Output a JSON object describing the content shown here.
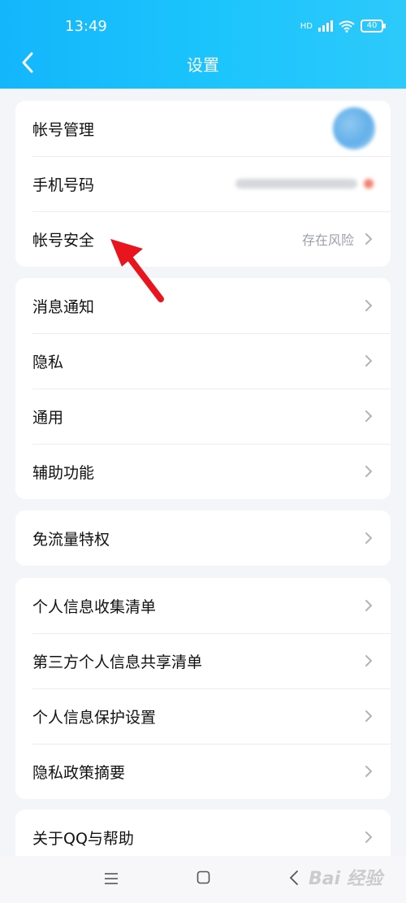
{
  "status_bar": {
    "time": "13:49",
    "network": "HD",
    "battery": "40"
  },
  "header": {
    "title": "设置"
  },
  "sections": [
    {
      "rows": [
        {
          "label": "帐号管理",
          "value": ""
        },
        {
          "label": "手机号码",
          "value": ""
        },
        {
          "label": "帐号安全",
          "value": "存在风险"
        }
      ]
    },
    {
      "rows": [
        {
          "label": "消息通知"
        },
        {
          "label": "隐私"
        },
        {
          "label": "通用"
        },
        {
          "label": "辅助功能"
        }
      ]
    },
    {
      "rows": [
        {
          "label": "免流量特权"
        }
      ]
    },
    {
      "rows": [
        {
          "label": "个人信息收集清单"
        },
        {
          "label": "第三方个人信息共享清单"
        },
        {
          "label": "个人信息保护设置"
        },
        {
          "label": "隐私政策摘要"
        }
      ]
    },
    {
      "rows": [
        {
          "label": "关于QQ与帮助"
        }
      ]
    }
  ],
  "watermark": "Bai 经验",
  "colors": {
    "header": "#1cc5fc",
    "background": "#f4f5f9",
    "arrow": "#e8141e",
    "secondary_text": "#9aa0a6"
  }
}
